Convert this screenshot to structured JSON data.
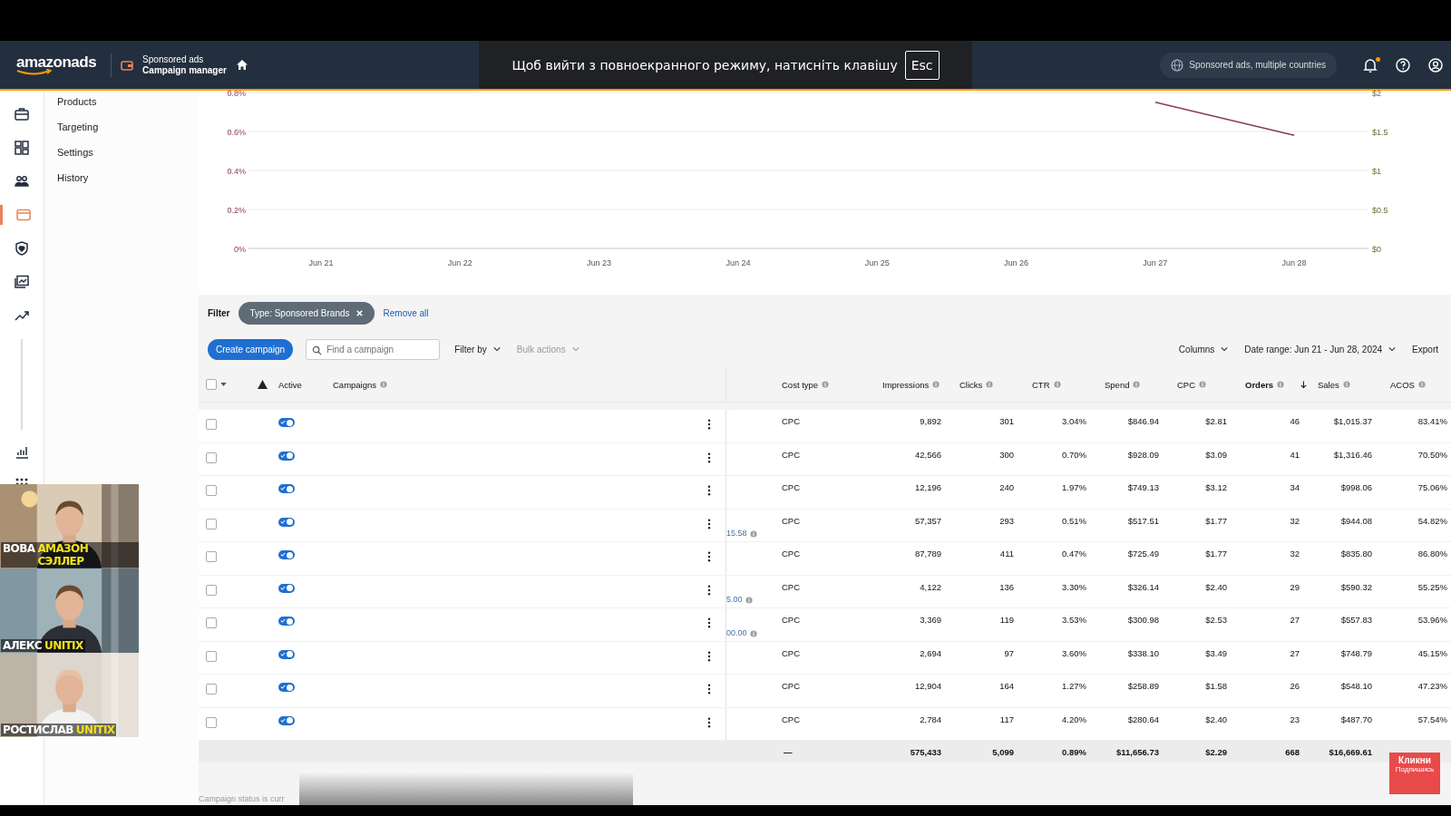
{
  "header": {
    "logo": "amazonads",
    "product_line": "Sponsored ads",
    "product": "Campaign manager",
    "account": "Sponsored ads, multiple countries",
    "notification_dot": true
  },
  "fullscreen_notice": {
    "text": "Щоб вийти з повноекранного режиму, натисніть клавішу",
    "key": "Esc"
  },
  "rail": [
    {
      "kind": "briefcase",
      "selected": false
    },
    {
      "kind": "dashboard",
      "selected": false
    },
    {
      "kind": "people",
      "selected": false
    },
    {
      "kind": "wallet",
      "selected": true
    },
    {
      "kind": "shield",
      "selected": false
    },
    {
      "kind": "gallery",
      "selected": false
    },
    {
      "kind": "trend",
      "selected": false
    },
    {
      "kind": "bars",
      "selected": false
    },
    {
      "kind": "apps",
      "selected": false
    }
  ],
  "submenu": [
    "Products",
    "Targeting",
    "Settings",
    "History"
  ],
  "chart_data": {
    "type": "line",
    "categories": [
      "Jun 21",
      "Jun 22",
      "Jun 23",
      "Jun 24",
      "Jun 25",
      "Jun 26",
      "Jun 27",
      "Jun 28"
    ],
    "series": [
      {
        "color": "#8a3b5c",
        "values": [
          null,
          null,
          null,
          null,
          null,
          null,
          0.75,
          0.58
        ]
      }
    ],
    "grid": true,
    "ylim": [
      0,
      0.8
    ],
    "y2lim": [
      0,
      2
    ],
    "yticks": [
      {
        "value": 0,
        "label": "0%"
      },
      {
        "value": 0.2,
        "label": "0.2%"
      },
      {
        "value": 0.4,
        "label": "0.4%"
      },
      {
        "value": 0.6,
        "label": "0.6%"
      },
      {
        "value": 0.8,
        "label": "0.8%"
      }
    ],
    "y2ticks": [
      {
        "value": 0,
        "label": "$0"
      },
      {
        "value": 0.5,
        "label": "$0.5"
      },
      {
        "value": 1,
        "label": "$1"
      },
      {
        "value": 1.5,
        "label": "$1.5"
      },
      {
        "value": 2,
        "label": "$2"
      }
    ]
  },
  "filter": {
    "label": "Filter",
    "chip": "Type: Sponsored Brands",
    "remove_all": "Remove all"
  },
  "toolbar": {
    "create": "Create campaign",
    "search_placeholder": "Find a campaign",
    "filter_by": "Filter by",
    "bulk_actions": "Bulk actions",
    "bulk_disabled": true,
    "columns": "Columns",
    "date_range": "Date range: Jun 21 - Jun 28, 2024",
    "export": "Export"
  },
  "select_all_checked": false,
  "columns": [
    {
      "label": "Active",
      "info": false,
      "sorted": false
    },
    {
      "label": "Campaigns",
      "info": true,
      "sorted": false
    },
    {
      "label": "Cost type",
      "info": true,
      "sorted": false
    },
    {
      "label": "Impressions",
      "info": true,
      "sorted": false
    },
    {
      "label": "Clicks",
      "info": true,
      "sorted": false
    },
    {
      "label": "CTR",
      "info": true,
      "sorted": false
    },
    {
      "label": "Spend",
      "info": true,
      "sorted": false
    },
    {
      "label": "CPC",
      "info": true,
      "sorted": false
    },
    {
      "label": "Orders",
      "info": true,
      "sorted": true
    },
    {
      "label": "Sales",
      "info": true,
      "sorted": false
    },
    {
      "label": "ACOS",
      "info": true,
      "sorted": false
    }
  ],
  "rows": [
    {
      "checked": false,
      "active": true,
      "cost_type": "CPC",
      "impressions": "9,892",
      "clicks": "301",
      "ctr": "3.04%",
      "spend": "$846.94",
      "cpc": "$2.81",
      "orders": "46",
      "sales": "$1,015.37",
      "acos": "83.41%"
    },
    {
      "checked": false,
      "active": true,
      "cost_type": "CPC",
      "impressions": "42,566",
      "clicks": "300",
      "ctr": "0.70%",
      "spend": "$928.09",
      "cpc": "$3.09",
      "orders": "41",
      "sales": "$1,316.46",
      "acos": "70.50%"
    },
    {
      "checked": false,
      "active": true,
      "cost_type": "CPC",
      "impressions": "12,196",
      "clicks": "240",
      "ctr": "1.97%",
      "spend": "$749.13",
      "cpc": "$3.12",
      "orders": "34",
      "sales": "$998.06",
      "acos": "75.06%"
    },
    {
      "checked": false,
      "active": true,
      "column_5": "15.58",
      "cost_type": "CPC",
      "impressions": "57,357",
      "clicks": "293",
      "ctr": "0.51%",
      "spend": "$517.51",
      "cpc": "$1.77",
      "orders": "32",
      "sales": "$944.08",
      "acos": "54.82%"
    },
    {
      "checked": false,
      "active": true,
      "cost_type": "CPC",
      "impressions": "87,789",
      "clicks": "411",
      "ctr": "0.47%",
      "spend": "$725.49",
      "cpc": "$1.77",
      "orders": "32",
      "sales": "$835.80",
      "acos": "86.80%"
    },
    {
      "checked": false,
      "active": true,
      "column_5": "5.00",
      "cost_type": "CPC",
      "impressions": "4,122",
      "clicks": "136",
      "ctr": "3.30%",
      "spend": "$326.14",
      "cpc": "$2.40",
      "orders": "29",
      "sales": "$590.32",
      "acos": "55.25%"
    },
    {
      "checked": false,
      "active": true,
      "column_5": "00.00",
      "cost_type": "CPC",
      "impressions": "3,369",
      "clicks": "119",
      "ctr": "3.53%",
      "spend": "$300.98",
      "cpc": "$2.53",
      "orders": "27",
      "sales": "$557.83",
      "acos": "53.96%"
    },
    {
      "checked": false,
      "active": true,
      "cost_type": "CPC",
      "impressions": "2,694",
      "clicks": "97",
      "ctr": "3.60%",
      "spend": "$338.10",
      "cpc": "$3.49",
      "orders": "27",
      "sales": "$748.79",
      "acos": "45.15%"
    },
    {
      "checked": false,
      "active": true,
      "cost_type": "CPC",
      "impressions": "12,904",
      "clicks": "164",
      "ctr": "1.27%",
      "spend": "$258.89",
      "cpc": "$1.58",
      "orders": "26",
      "sales": "$548.10",
      "acos": "47.23%"
    },
    {
      "checked": false,
      "active": true,
      "cost_type": "CPC",
      "impressions": "2,784",
      "clicks": "117",
      "ctr": "4.20%",
      "spend": "$280.64",
      "cpc": "$2.40",
      "orders": "23",
      "sales": "$487.70",
      "acos": "57.54%"
    }
  ],
  "totals": {
    "cost_type": "—",
    "impressions": "575,433",
    "clicks": "5,099",
    "ctr": "0.89%",
    "spend": "$11,656.73",
    "cpc": "$2.29",
    "orders": "668",
    "sales": "$16,669.61"
  },
  "footnote": "Campaign status is curr",
  "webcams": [
    {
      "name": "ВОВА",
      "tag": "АМАЗОН СЭЛЛЕР"
    },
    {
      "name": "АЛЕКС",
      "tag": "UNITIX"
    },
    {
      "name": "РОСТИСЛАВ",
      "tag": "UNITIX"
    }
  ],
  "subscribe_badge": {
    "title": "Кликни",
    "subtitle": "Подпишись"
  }
}
